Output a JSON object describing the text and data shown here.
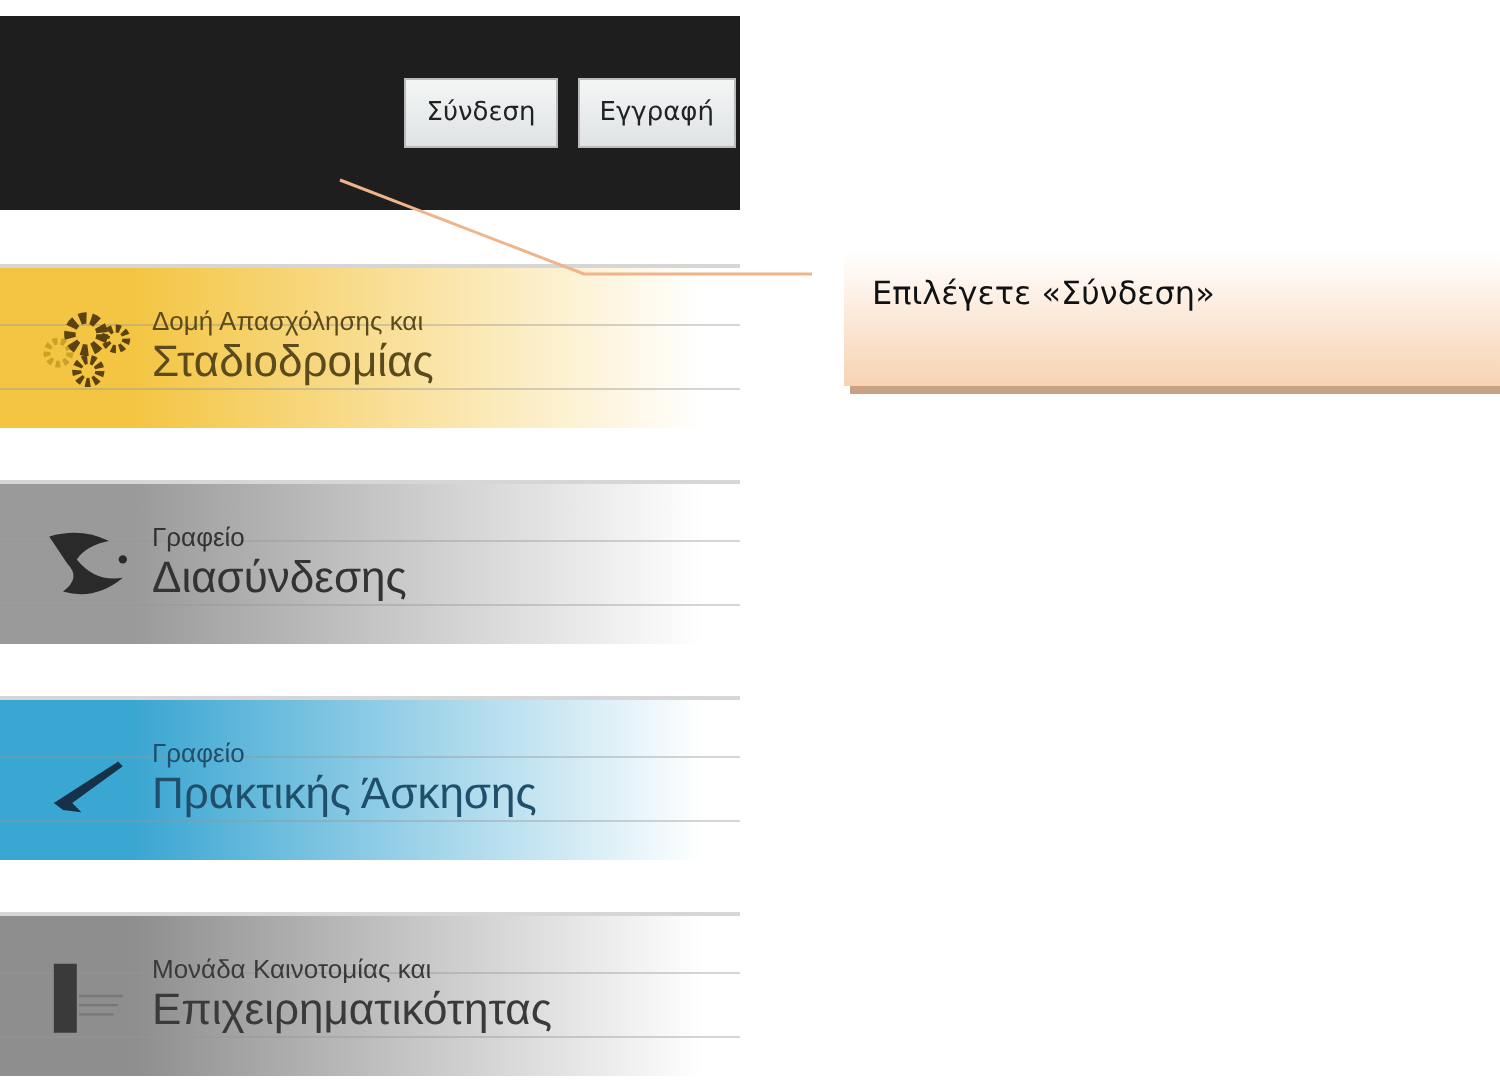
{
  "header": {
    "buttons": [
      {
        "label": "Σύνδεση"
      },
      {
        "label": "Εγγραφή"
      }
    ]
  },
  "banners": [
    {
      "kind": "gears",
      "color": "#f4c542",
      "small": "Δομή Απασχόλησης και",
      "large": "Σταδιοδρομίας"
    },
    {
      "kind": "swirl",
      "color": "#9a9a9a",
      "small": "Γραφείο",
      "large": "Διασύνδεσης"
    },
    {
      "kind": "plane",
      "color": "#3aa6d2",
      "small": "Γραφείο",
      "large": "Πρακτικής Άσκησης"
    },
    {
      "kind": "pillar",
      "color": "#8e8e8e",
      "small": "Μονάδα Καινοτομίας και",
      "large": "Επιχειρηματικότητας"
    }
  ],
  "callout": {
    "text": "Επιλέγετε «Σύνδεση»"
  }
}
